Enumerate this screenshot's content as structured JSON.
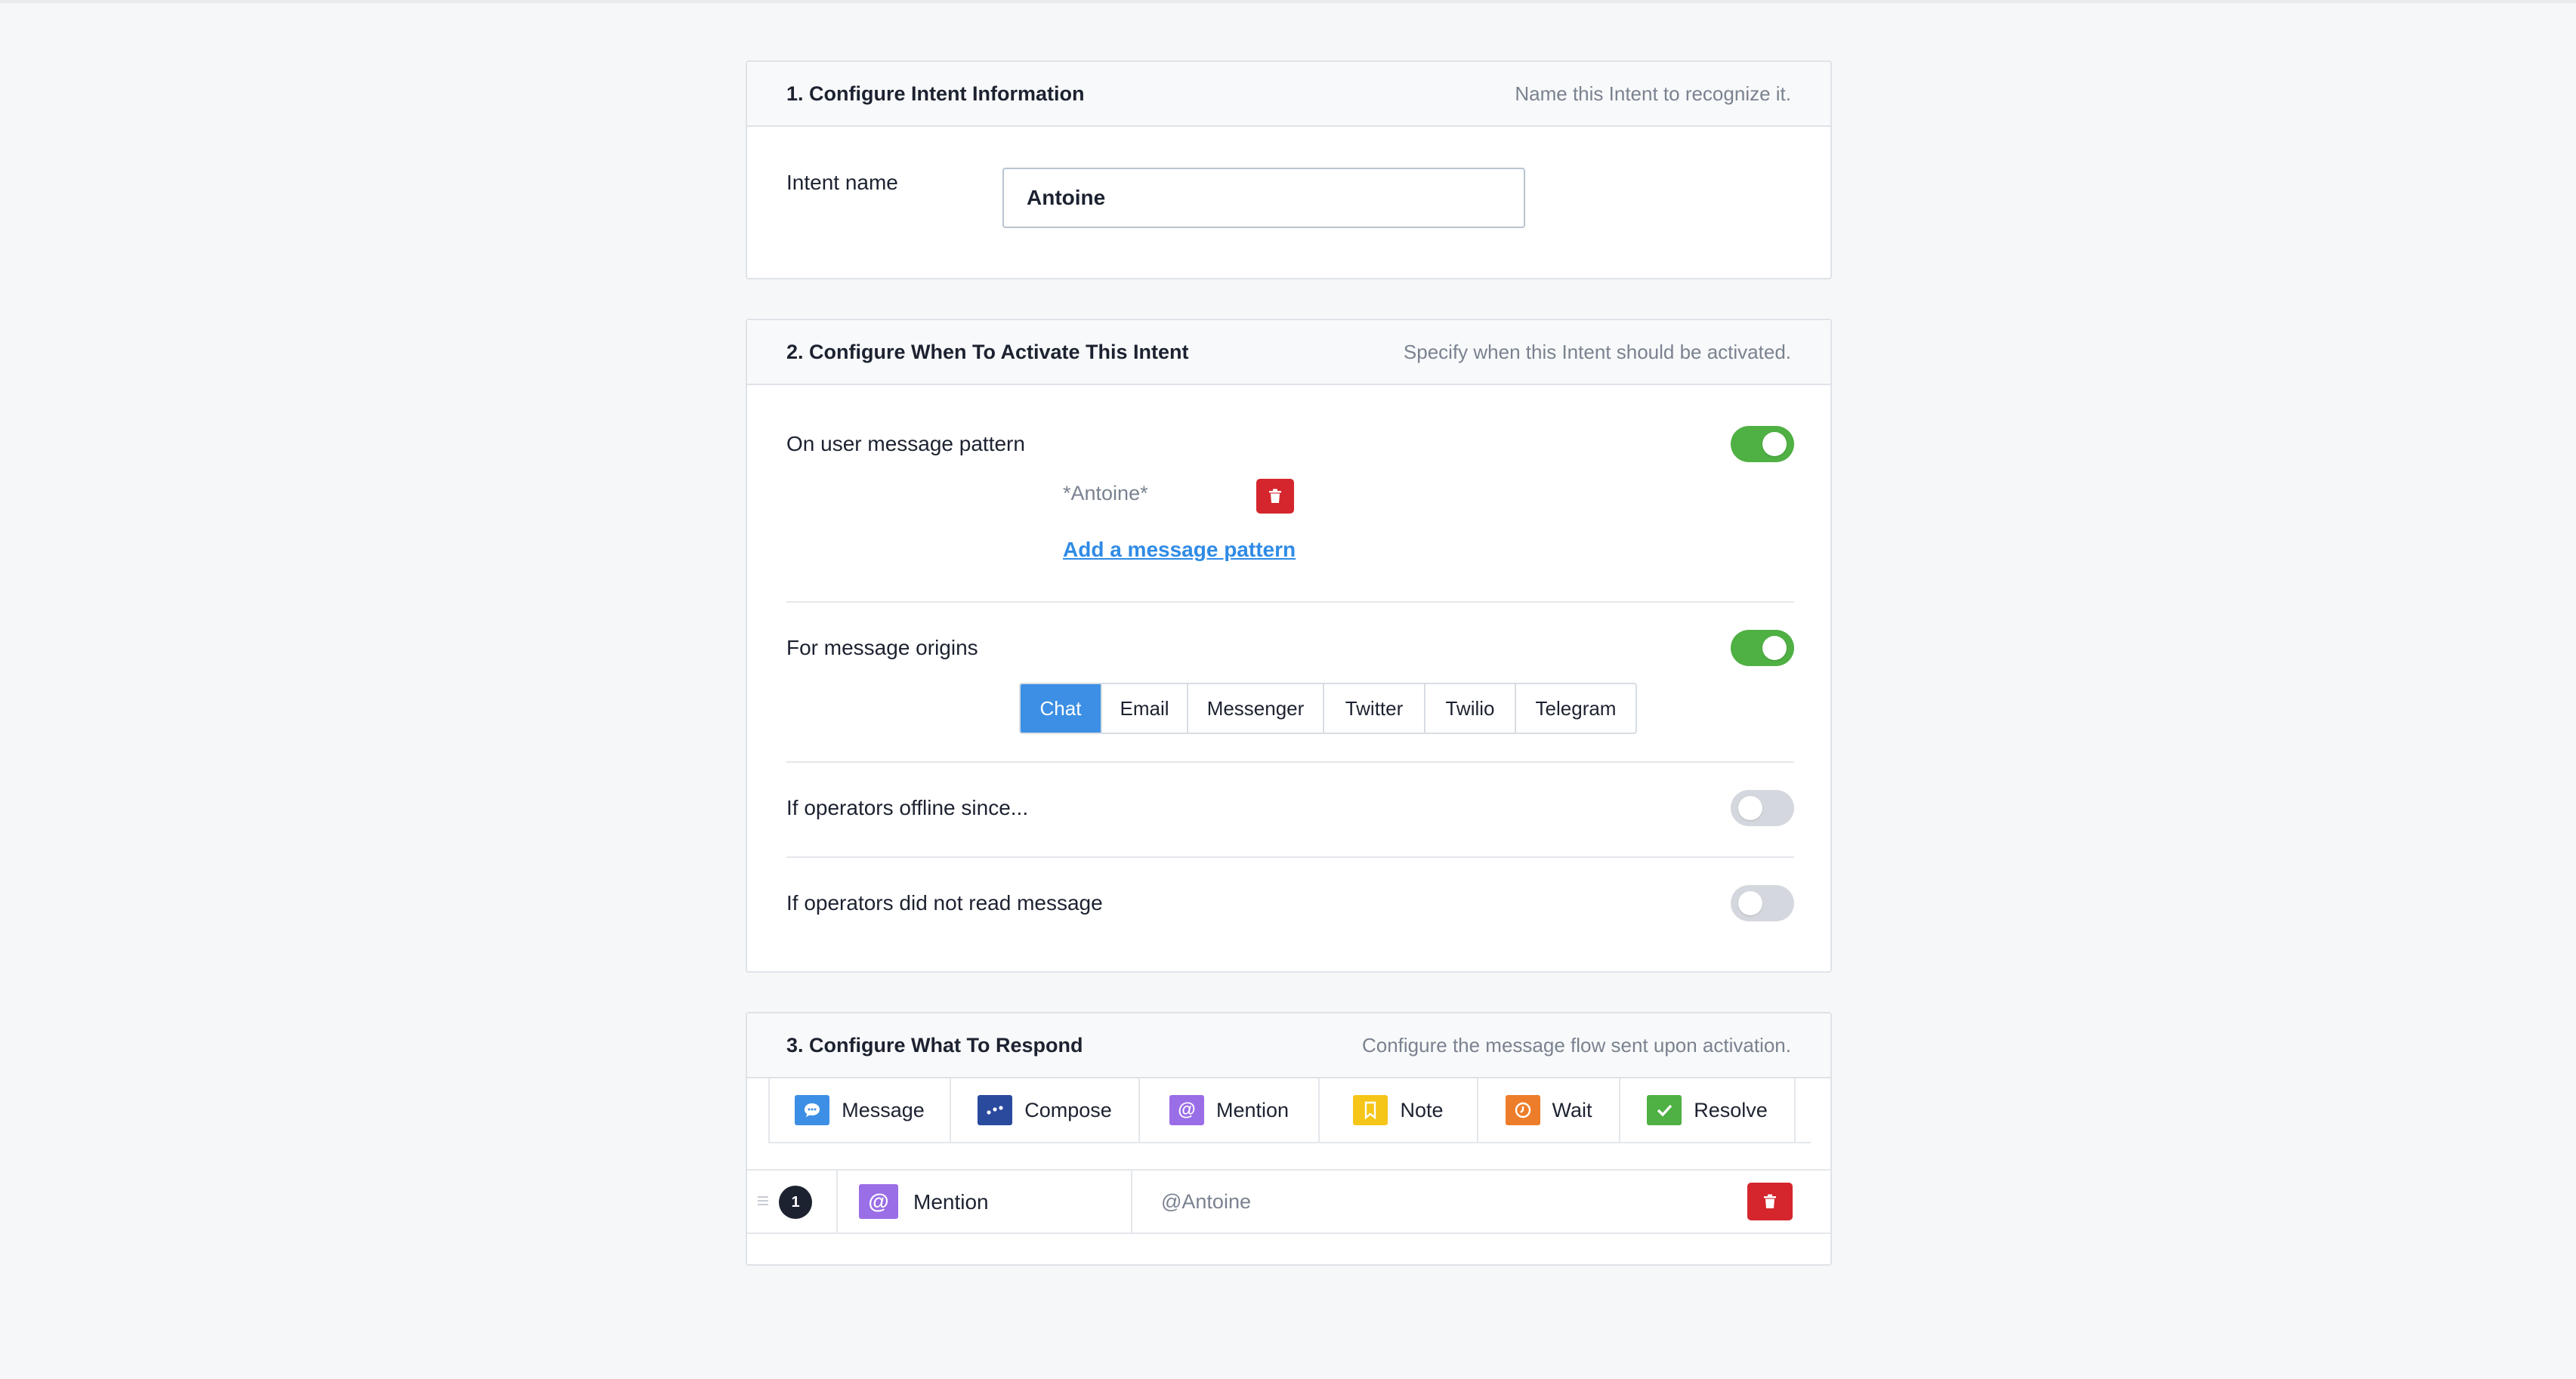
{
  "section1": {
    "title": "1. Configure Intent Information",
    "hint": "Name this Intent to recognize it.",
    "intent_label": "Intent name",
    "intent_value": "Antoine"
  },
  "section2": {
    "title": "2. Configure When To Activate This Intent",
    "hint": "Specify when this Intent should be activated.",
    "message_pattern": {
      "label": "On user message pattern",
      "enabled": true,
      "patterns": [
        "*Antoine*"
      ],
      "add_link": "Add a message pattern"
    },
    "message_origins": {
      "label": "For message origins",
      "enabled": true,
      "options": [
        "Chat",
        "Email",
        "Messenger",
        "Twitter",
        "Twilio",
        "Telegram"
      ],
      "selected": "Chat"
    },
    "operators_offline": {
      "label": "If operators offline since...",
      "enabled": false
    },
    "operators_unread": {
      "label": "If operators did not read message",
      "enabled": false
    }
  },
  "section3": {
    "title": "3. Configure What To Respond",
    "hint": "Configure the message flow sent upon activation.",
    "tools": [
      {
        "label": "Message",
        "icon": "chat-bubble-icon",
        "color": "#3c8fe4"
      },
      {
        "label": "Compose",
        "icon": "typing-dots-icon",
        "color": "#2a4a9e"
      },
      {
        "label": "Mention",
        "icon": "at-sign-icon",
        "color": "#9a6ee6"
      },
      {
        "label": "Note",
        "icon": "bookmark-icon",
        "color": "#f5c518"
      },
      {
        "label": "Wait",
        "icon": "clock-icon",
        "color": "#ee7d2b"
      },
      {
        "label": "Resolve",
        "icon": "checkmark-icon",
        "color": "#4fb043"
      }
    ],
    "steps": [
      {
        "number": "1",
        "type": "Mention",
        "value": "@Antoine"
      }
    ]
  },
  "colors": {
    "accent": "#3c8fe4",
    "toggle_on": "#4fb043",
    "danger": "#d4262c"
  }
}
